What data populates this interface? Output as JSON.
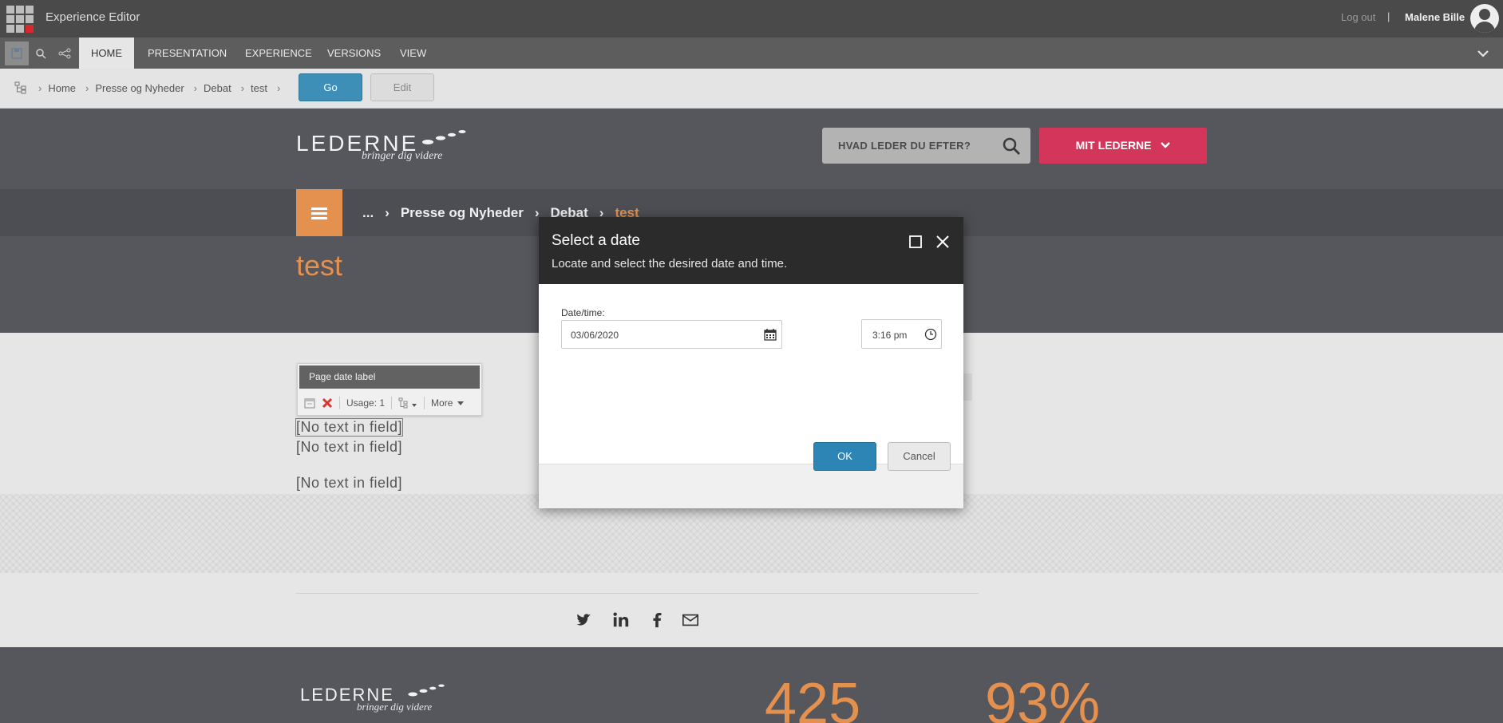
{
  "app": {
    "title": "Experience Editor",
    "logout_label": "Log out",
    "separator": "|",
    "user_name": "Malene Bille"
  },
  "ribbon": {
    "tabs": [
      {
        "label": "HOME",
        "active": true
      },
      {
        "label": "PRESENTATION"
      },
      {
        "label": "EXPERIENCE"
      },
      {
        "label": "VERSIONS"
      },
      {
        "label": "VIEW"
      }
    ]
  },
  "breadcrumb": {
    "items": [
      "Home",
      "Presse og Nyheder",
      "Debat",
      "test"
    ],
    "go_label": "Go",
    "edit_label": "Edit"
  },
  "site": {
    "logo_text": "LEDERNE",
    "logo_tagline": "bringer dig videre",
    "search_placeholder": "HVAD LEDER DU EFTER?",
    "mit_label": "MIT LEDERNE",
    "nav_crumbs": [
      "...",
      "Presse og Nyheder",
      "Debat"
    ],
    "nav_current": "test",
    "page_title": "test",
    "brand_orange": "#e4904e",
    "brand_pink": "#d4355b"
  },
  "field_chrome": {
    "title": "Page date label",
    "usage": "Usage: 1",
    "more_label": "More"
  },
  "fields": [
    "[No text in field]",
    "[No text in field]",
    "[No text in field]"
  ],
  "footer": {
    "stat1": "425",
    "stat2": "93%"
  },
  "modal": {
    "title": "Select a date",
    "subtitle": "Locate and select the desired date and time.",
    "datetime_label": "Date/time:",
    "date_value": "03/06/2020",
    "time_value": "3:16 pm",
    "ok_label": "OK",
    "cancel_label": "Cancel"
  }
}
